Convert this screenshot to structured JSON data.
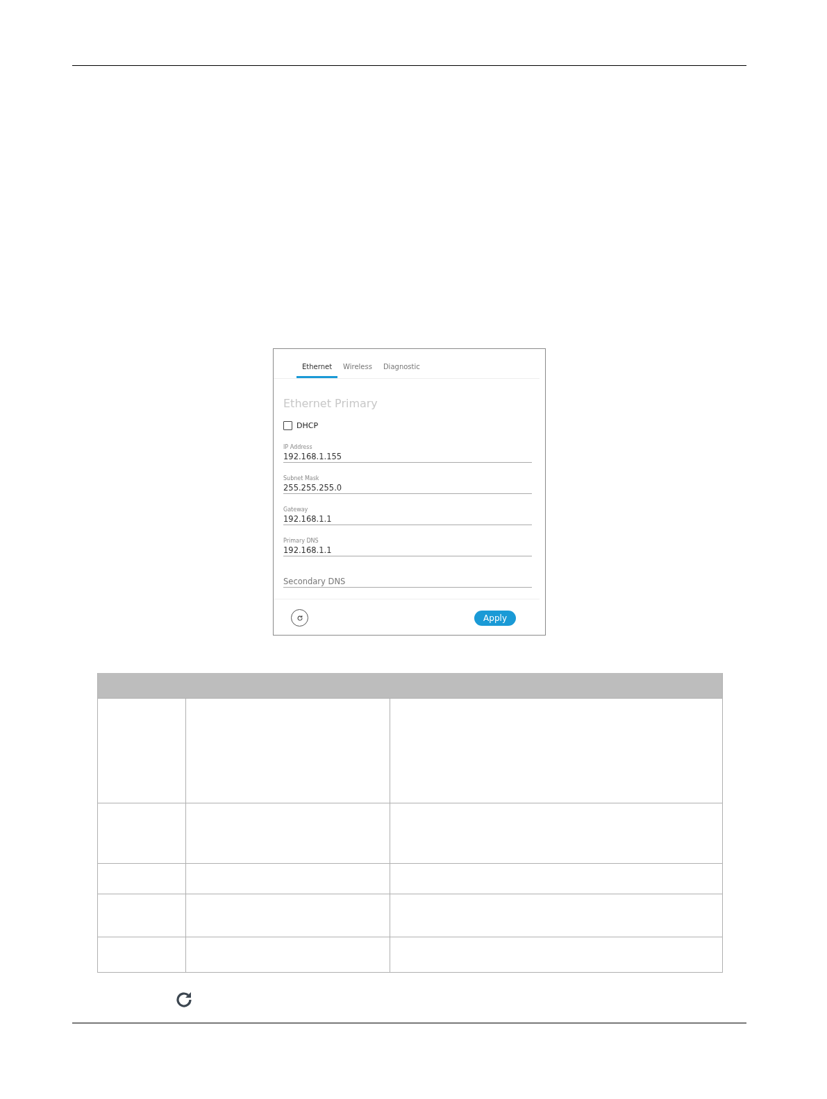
{
  "tabs": [
    {
      "label": "Ethernet",
      "selected": true
    },
    {
      "label": "Wireless",
      "selected": false
    },
    {
      "label": "Diagnostic",
      "selected": false
    }
  ],
  "section_title": "Ethernet Primary",
  "dhcp": {
    "label": "DHCP",
    "checked": false
  },
  "fields": [
    {
      "label": "IP Address",
      "value": "192.168.1.155"
    },
    {
      "label": "Subnet Mask",
      "value": "255.255.255.0"
    },
    {
      "label": "Gateway",
      "value": "192.168.1.1"
    },
    {
      "label": "Primary DNS",
      "value": "192.168.1.1"
    },
    {
      "placeholder": "Secondary DNS"
    }
  ],
  "apply_button": "Apply"
}
